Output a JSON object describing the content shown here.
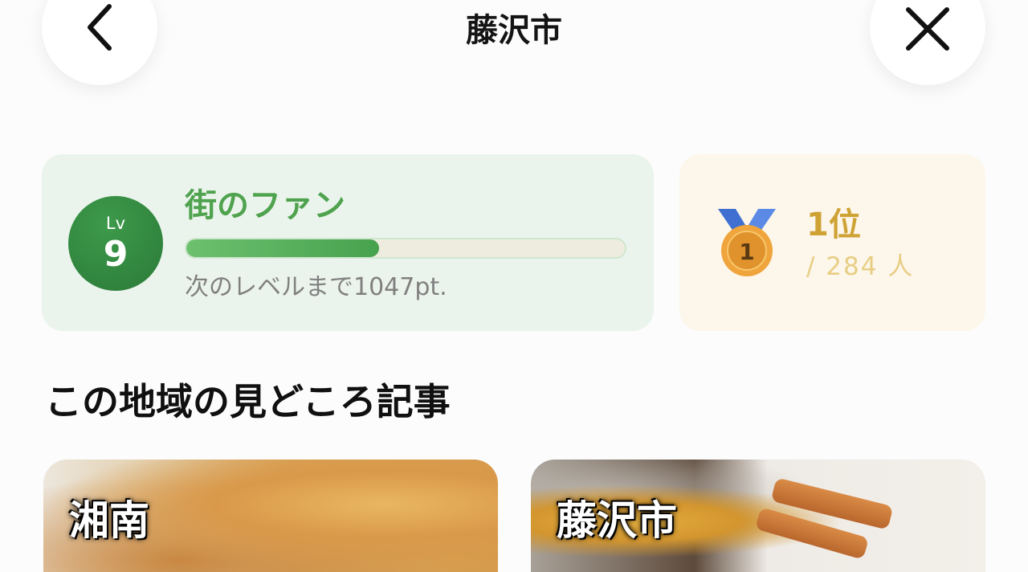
{
  "header": {
    "title": "藤沢市",
    "back_icon": "chevron-left-icon",
    "close_icon": "close-icon"
  },
  "level_card": {
    "lv_label": "Lv",
    "level": "9",
    "level_title": "街のファン",
    "progress_fraction": 0.44,
    "next_level_text": "次のレベルまで1047pt.",
    "accent_color": "#4fa24e"
  },
  "rank_card": {
    "medal_icon": "gold-medal-icon",
    "medal_number": "1",
    "rank": "1位",
    "total": "/ 284 人",
    "accent_color": "#cfa235"
  },
  "section": {
    "heading": "この地域の見どころ記事"
  },
  "articles": [
    {
      "label": "湘南"
    },
    {
      "label": "藤沢市"
    }
  ]
}
